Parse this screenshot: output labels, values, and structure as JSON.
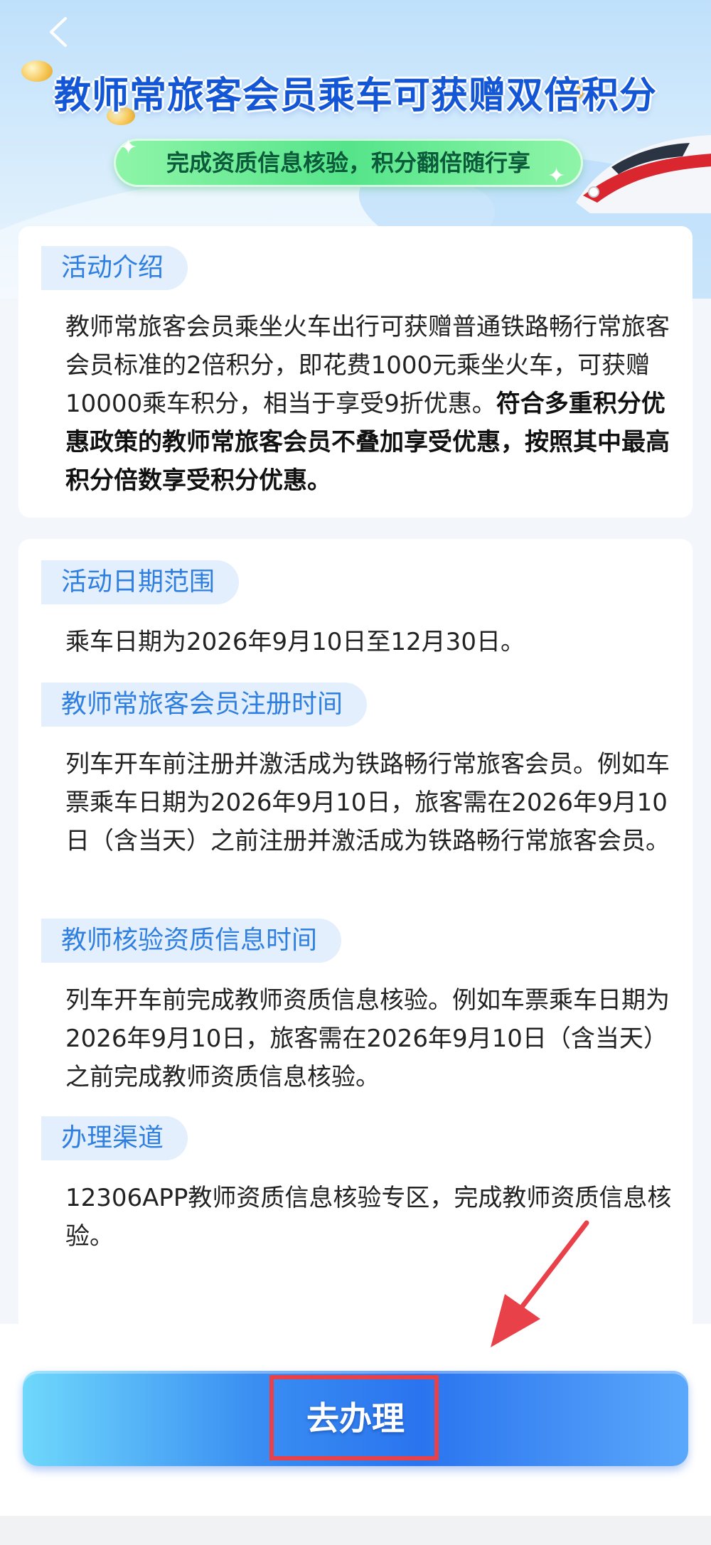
{
  "header": {
    "back_icon": "chevron-left-icon",
    "title": "教师常旅客会员乘车可获赠双倍积分",
    "subtitle": "完成资质信息核验，积分翻倍随行享"
  },
  "intro": {
    "tag": "活动介绍",
    "text": "教师常旅客会员乘坐火车出行可获赠普通铁路畅行常旅客会员标准的2倍积分，即花费1000元乘坐火车，可获赠10000乘车积分，相当于享受9折优惠。",
    "bold_text": "符合多重积分优惠政策的教师常旅客会员不叠加享受优惠，按照其中最高积分倍数享受积分优惠。"
  },
  "sections": [
    {
      "tag": "活动日期范围",
      "text": "乘车日期为2026年9月10日至12月30日。"
    },
    {
      "tag": "教师常旅客会员注册时间",
      "text": "列车开车前注册并激活成为铁路畅行常旅客会员。例如车票乘车日期为2026年9月10日，旅客需在2026年9月10日（含当天）之前注册并激活成为铁路畅行常旅客会员。"
    },
    {
      "tag": "教师核验资质信息时间",
      "text": "列车开车前完成教师资质信息核验。例如车票乘车日期为2026年9月10日，旅客需在2026年9月10日（含当天）之前完成教师资质信息核验。"
    },
    {
      "tag": "办理渠道",
      "text": "12306APP教师资质信息核验专区，完成教师资质信息核验。"
    }
  ],
  "action": {
    "button_label": "去办理",
    "highlight_color": "#e8414a"
  },
  "colors": {
    "accent_blue": "#2f7fe0",
    "title_blue": "#1457d6",
    "pill_green": "#55e48a"
  }
}
